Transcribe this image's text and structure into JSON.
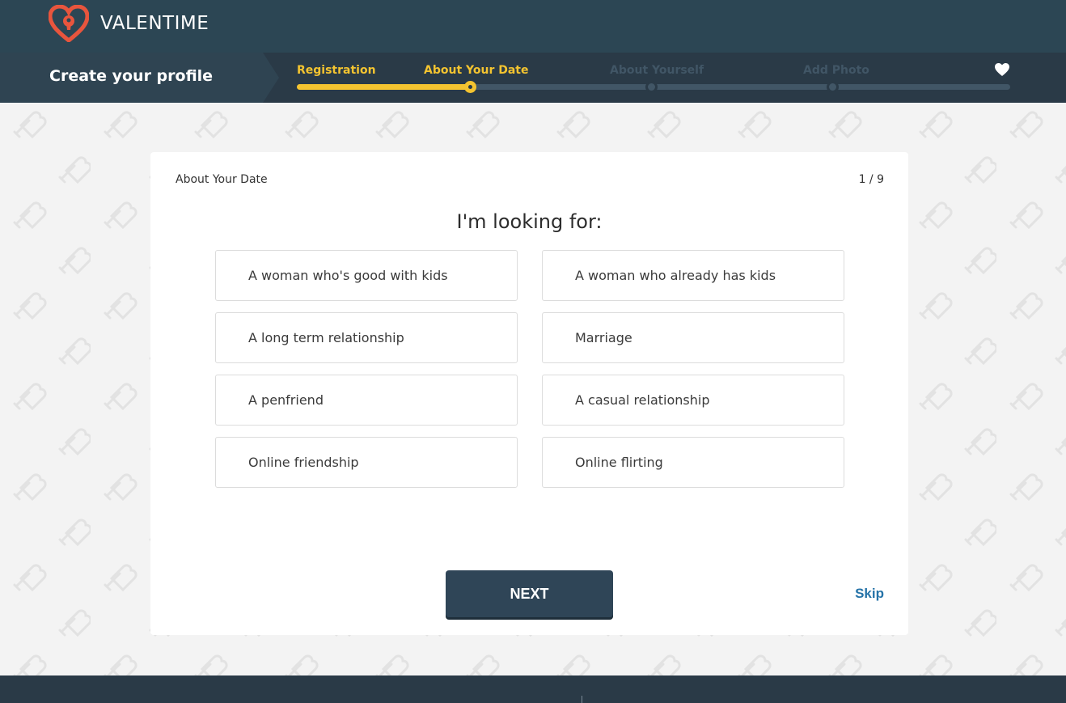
{
  "brand": {
    "name": "VALENTIME",
    "logo_icon": "heart-keyhole-icon",
    "accent": "#e8553d"
  },
  "progress": {
    "title": "Create your profile",
    "steps": [
      {
        "label": "Registration",
        "state": "done"
      },
      {
        "label": "About Your Date",
        "state": "current"
      },
      {
        "label": "About Yourself",
        "state": "upcoming"
      },
      {
        "label": "Add Photo",
        "state": "upcoming"
      }
    ],
    "end_icon": "heart-icon",
    "progress_fraction": 0.25,
    "colors": {
      "complete": "#f4c430",
      "incomplete": "#415666"
    }
  },
  "card": {
    "section": "About Your Date",
    "counter": "1 / 9",
    "question": "I'm looking for:",
    "options": [
      "A woman who's good with kids",
      "A woman who already has kids",
      "A long term relationship",
      "Marriage",
      "A penfriend",
      "A casual relationship",
      "Online friendship",
      "Online flirting"
    ],
    "next_label": "NEXT",
    "skip_label": "Skip"
  }
}
